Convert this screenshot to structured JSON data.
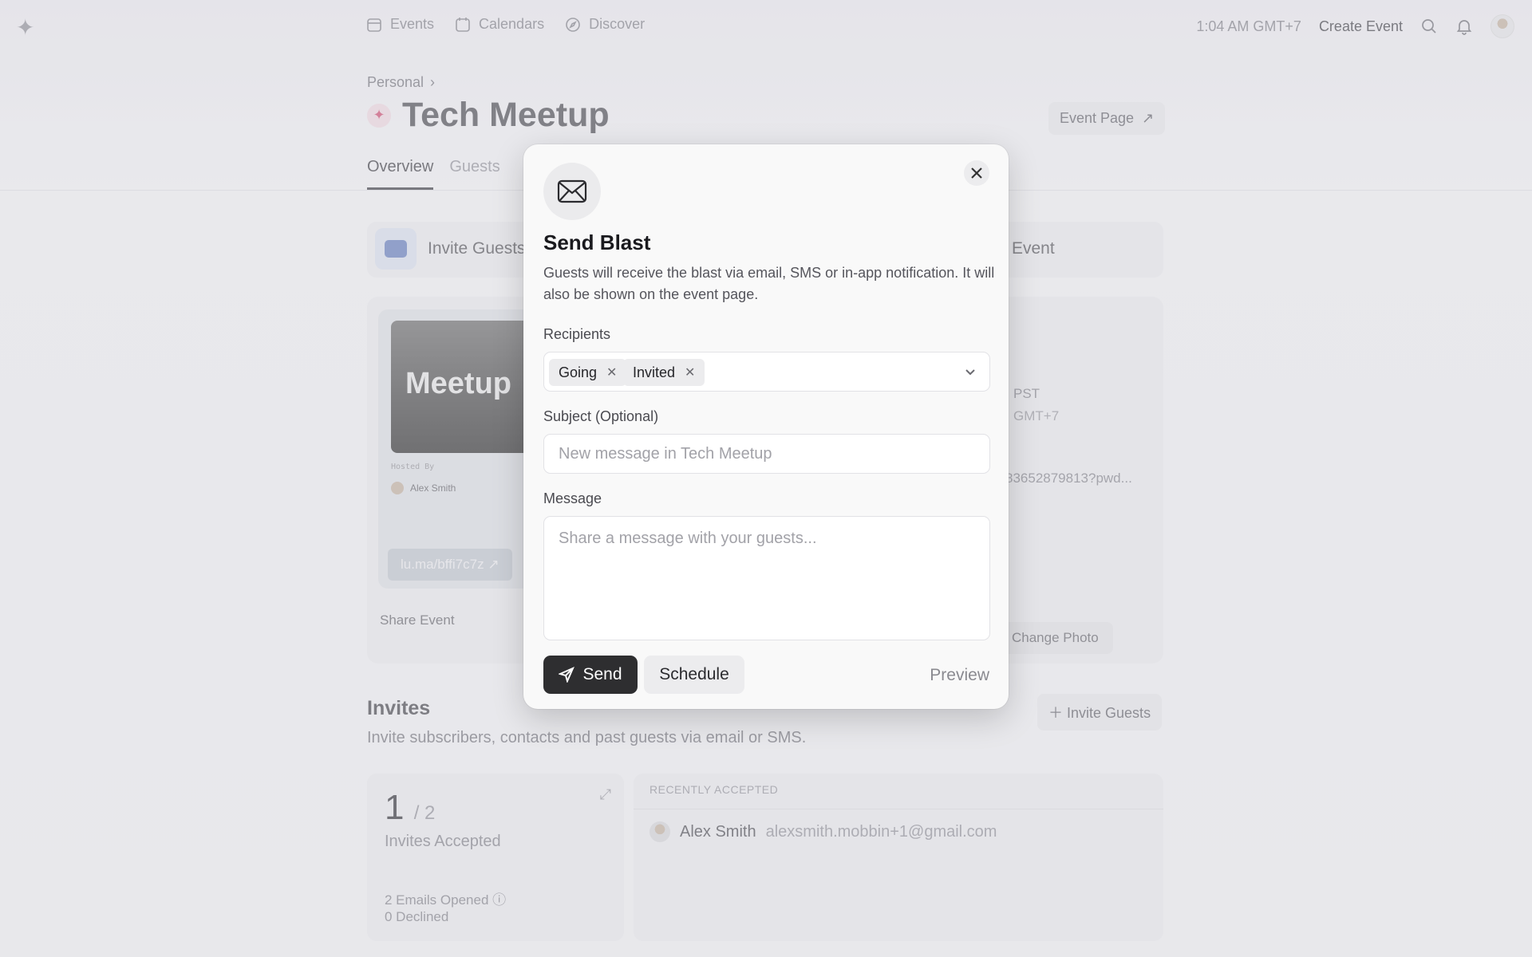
{
  "topbar": {
    "nav": [
      {
        "label": "Events",
        "icon": "calendar-grid-icon"
      },
      {
        "label": "Calendars",
        "icon": "calendar-icon"
      },
      {
        "label": "Discover",
        "icon": "compass-icon"
      }
    ],
    "time": "1:04 AM GMT+7",
    "create_event": "Create Event"
  },
  "header": {
    "breadcrumb": "Personal",
    "title": "Tech Meetup",
    "event_page": "Event Page",
    "tabs": [
      "Overview",
      "Guests"
    ]
  },
  "quick_actions": {
    "invite": "Invite Guests",
    "event_fragment": "Event"
  },
  "event_card": {
    "cover_text": "Meetup",
    "hosted_by": "Hosted By",
    "host": "Alex Smith",
    "short_link": "lu.ma/bffi7c7z",
    "share": "Share Event",
    "frag_tz1": "PST",
    "frag_tz2": "GMT+7",
    "frag_link": "83652879813?pwd...",
    "change_photo": "Change Photo"
  },
  "invites": {
    "title": "Invites",
    "subtitle": "Invite subscribers, contacts and past guests via email or SMS.",
    "invite_button": "Invite Guests",
    "accepted_count": "1",
    "total": "/ 2",
    "accepted_label": "Invites Accepted",
    "emails_opened": "2 Emails Opened",
    "declined": "0 Declined",
    "recent_header": "RECENTLY ACCEPTED",
    "recent_name": "Alex Smith",
    "recent_email": "alexsmith.mobbin+1@gmail.com"
  },
  "modal": {
    "title": "Send Blast",
    "description": "Guests will receive the blast via email, SMS or in-app notification. It will also be shown on the event page.",
    "recipients_label": "Recipients",
    "recipients": [
      "Going",
      "Invited"
    ],
    "subject_label": "Subject (Optional)",
    "subject_placeholder": "New message in Tech Meetup",
    "message_label": "Message",
    "message_placeholder": "Share a message with your guests...",
    "send": "Send",
    "schedule": "Schedule",
    "preview": "Preview"
  }
}
